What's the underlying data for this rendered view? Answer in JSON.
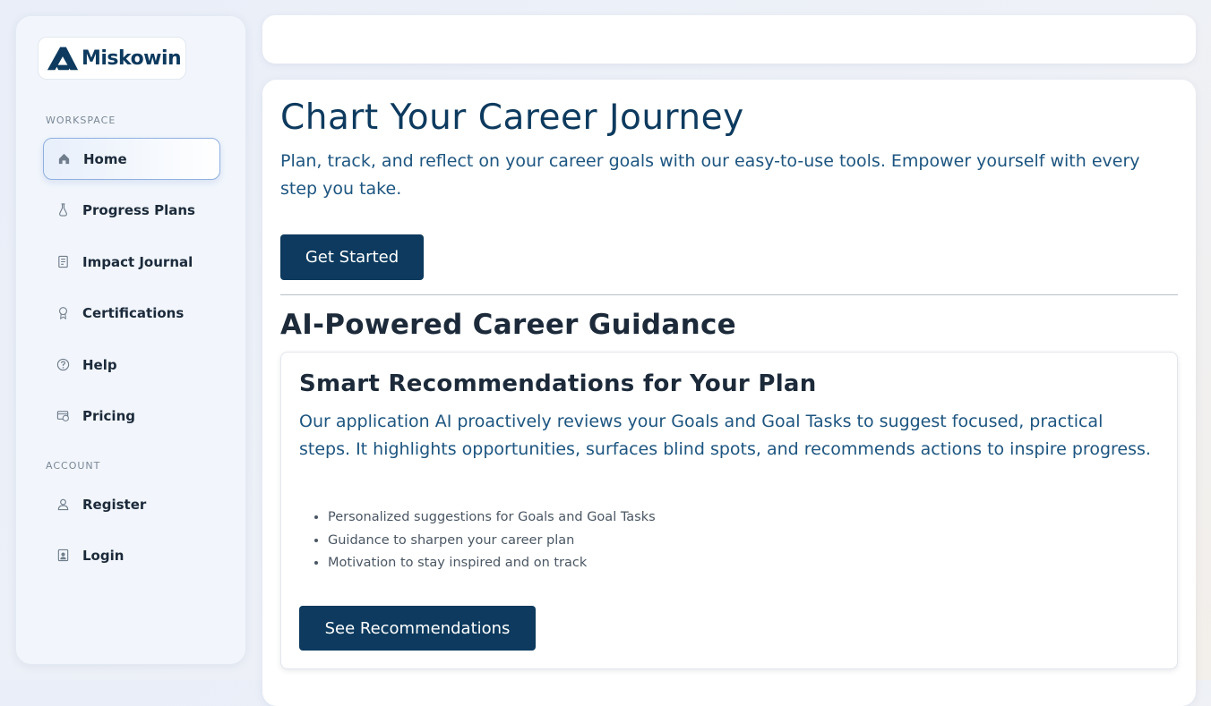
{
  "brand": {
    "name": "Miskowin"
  },
  "sidebar": {
    "workspace_label": "WORKSPACE",
    "account_label": "ACCOUNT",
    "workspace_items": [
      {
        "label": "Home",
        "icon": "home-icon",
        "active": true
      },
      {
        "label": "Progress Plans",
        "icon": "flask-icon"
      },
      {
        "label": "Impact Journal",
        "icon": "journal-icon"
      },
      {
        "label": "Certifications",
        "icon": "award-icon"
      },
      {
        "label": "Help",
        "icon": "help-icon"
      },
      {
        "label": "Pricing",
        "icon": "pricing-icon"
      }
    ],
    "account_items": [
      {
        "label": "Register",
        "icon": "user-icon"
      },
      {
        "label": "Login",
        "icon": "login-icon"
      }
    ]
  },
  "hero": {
    "title": "Chart Your Career Journey",
    "subtitle": "Plan, track, and reflect on your career goals with our easy-to-use tools. Empower yourself with every step you take.",
    "cta_label": "Get Started"
  },
  "guidance": {
    "section_title": "AI-Powered Career Guidance",
    "card_title": "Smart Recommendations for Your Plan",
    "card_text": "Our application AI proactively reviews your Goals and Goal Tasks to suggest focused, practical steps. It highlights opportunities, surfaces blind spots, and recommends actions to inspire progress.",
    "bullets": [
      "Personalized suggestions for Goals and Goal Tasks",
      "Guidance to sharpen your career plan",
      "Motivation to stay inspired and on track"
    ],
    "cta_label": "See Recommendations"
  },
  "colors": {
    "primary": "#0d3a5e",
    "accent_text": "#1d5580",
    "sidebar_bg": "#f2f6fc"
  }
}
